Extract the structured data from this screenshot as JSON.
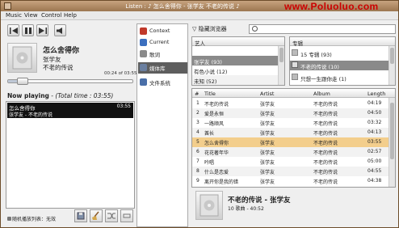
{
  "titlebar": {
    "title": "Listen : ♪ 怎么舍得你 - 张学友 不老的传说 ♪",
    "watermark": "www.Poluoluo.com"
  },
  "menu": {
    "music": "Music",
    "view": "View",
    "control": "Control",
    "help": "Help"
  },
  "player": {
    "song_title": "怎么舍得你",
    "artist": "张学友",
    "album": "不老的传说",
    "time": "00:24 of 03:55",
    "progress": 0.1
  },
  "now_playing": {
    "label": "Now playing",
    "total": " - (Total time : 03:55)"
  },
  "playlist": [
    {
      "title": "怎么舍得你",
      "duration": "03:55",
      "subtitle": "张学友 - 不老的传说"
    }
  ],
  "repeat_label": "随机播放列表：无效",
  "sidebar": [
    {
      "label": "Context",
      "color": "#c0392b"
    },
    {
      "label": "Current",
      "color": "#3b6fbf"
    },
    {
      "label": "歌词",
      "color": "#8a8a8a"
    },
    {
      "label": "媒体库",
      "color": "#6a7fa0"
    },
    {
      "label": "文件系统",
      "color": "#4a6fa8"
    }
  ],
  "browser": {
    "toggle_label": "隐藏浏览器",
    "search_placeholder": "",
    "artists_header": "艺人",
    "artists": [
      {
        "label": "张学友 (93)",
        "selected": true
      },
      {
        "label": "有色小说 (12)",
        "selected": false
      },
      {
        "label": "未知 (52)",
        "selected": false
      }
    ],
    "albums_header": "专辑",
    "albums": [
      {
        "label": "15 专辑 (93)",
        "selected": false
      },
      {
        "label": "不老的传说 (10)",
        "selected": true
      },
      {
        "label": "只想一生跟你走 (1)",
        "selected": false
      }
    ]
  },
  "tracks": {
    "headers": {
      "num": "#",
      "title": "Title",
      "artist": "Artist",
      "album": "Album",
      "length": "Length"
    },
    "rows": [
      {
        "num": "1",
        "title": "不老的传说",
        "artist": "张学友",
        "album": "不老的传说",
        "length": "04:19"
      },
      {
        "num": "2",
        "title": "爱是永恒",
        "artist": "张学友",
        "album": "不老的传说",
        "length": "04:50"
      },
      {
        "num": "3",
        "title": "一路顺风",
        "artist": "张学友",
        "album": "不老的传说",
        "length": "03:32"
      },
      {
        "num": "4",
        "title": "酋长",
        "artist": "张学友",
        "album": "不老的传说",
        "length": "04:13"
      },
      {
        "num": "5",
        "title": "怎么舍得你",
        "artist": "张学友",
        "album": "不老的传说",
        "length": "03:55"
      },
      {
        "num": "6",
        "title": "花花著年华",
        "artist": "张学友",
        "album": "不老的传说",
        "length": "02:57"
      },
      {
        "num": "7",
        "title": "吟唱",
        "artist": "张学友",
        "album": "不老的传说",
        "length": "05:00"
      },
      {
        "num": "8",
        "title": "什么是恋爱",
        "artist": "张学友",
        "album": "不老的传说",
        "length": "04:55"
      },
      {
        "num": "9",
        "title": "离开你是我的错",
        "artist": "张学友",
        "album": "不老的传说",
        "length": "04:38"
      }
    ],
    "playing_index": 4
  },
  "album_info": {
    "title": "不老的传说 - 张学友",
    "details": "10 歌曲 - 40:52"
  }
}
